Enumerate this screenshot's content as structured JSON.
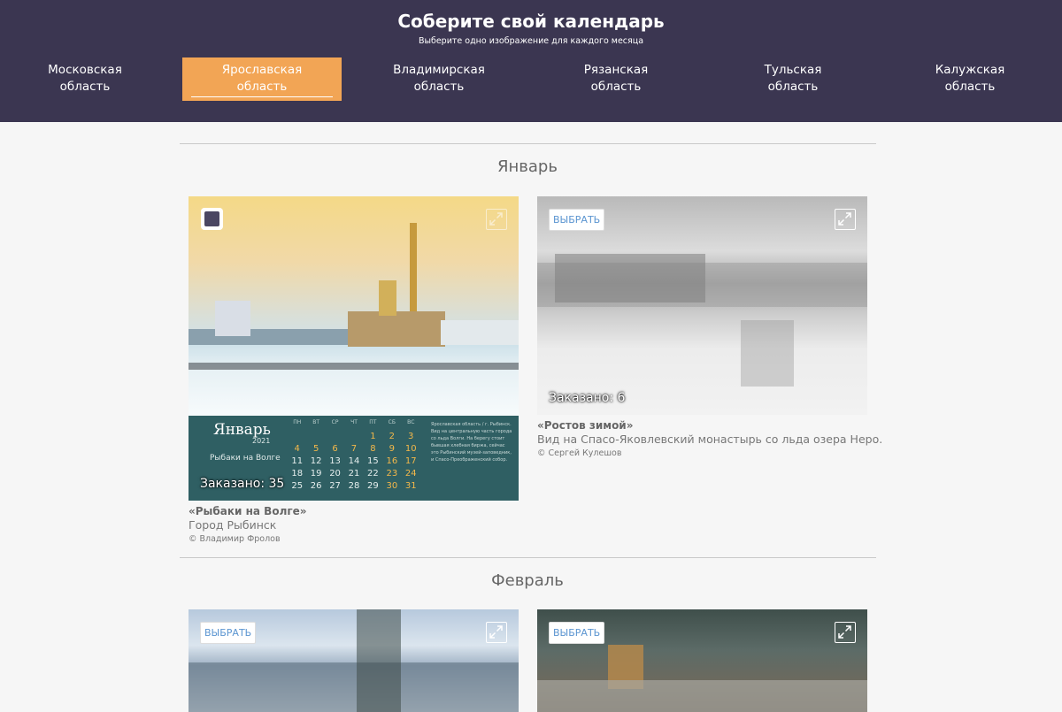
{
  "header": {
    "title": "Соберите свой календарь",
    "subtitle": "Выберите одно изображение для каждого месяца"
  },
  "tabs": [
    {
      "line1": "Московская",
      "line2": "область",
      "active": false
    },
    {
      "line1": "Ярославская",
      "line2": "область",
      "active": true
    },
    {
      "line1": "Владимирская",
      "line2": "область",
      "active": false
    },
    {
      "line1": "Рязанская",
      "line2": "область",
      "active": false
    },
    {
      "line1": "Тульская",
      "line2": "область",
      "active": false
    },
    {
      "line1": "Калужская",
      "line2": "область",
      "active": false
    }
  ],
  "months": [
    {
      "name": "Январь",
      "cards": [
        {
          "title": "«Рыбаки на Волге»",
          "description": "Город Рыбинск",
          "credit": "© Владимир Фролов",
          "ordered": "Заказано: 35",
          "selected": true,
          "calendar": {
            "month": "Январь",
            "year": "2021",
            "caption": "Рыбаки на Волге",
            "weekdays": [
              "ПН",
              "ВТ",
              "СР",
              "ЧТ",
              "ПТ",
              "СБ",
              "ВС"
            ],
            "weeks": [
              [
                "",
                "",
                "",
                "",
                "1",
                "2",
                "3"
              ],
              [
                "4",
                "5",
                "6",
                "7",
                "8",
                "9",
                "10"
              ],
              [
                "11",
                "12",
                "13",
                "14",
                "15",
                "16",
                "17"
              ],
              [
                "18",
                "19",
                "20",
                "21",
                "22",
                "23",
                "24"
              ],
              [
                "25",
                "26",
                "27",
                "28",
                "29",
                "30",
                "31"
              ]
            ],
            "note": "Ярославская область / г. Рыбинск. Вид на центральную часть города со льда Волги. На берегу стоит бывшая хлебная биржа, сейчас это Рыбинский музей-заповедник, и Спасо-Преображенский собор."
          }
        },
        {
          "title": "«Ростов зимой»",
          "description": "Вид на Спасо-Яковлевский монастырь со льда озера Неро.",
          "credit": "© Сергей Кулешов",
          "ordered": "Заказано: 6",
          "pick_label": "ВЫБРАТЬ"
        }
      ]
    },
    {
      "name": "Февраль",
      "cards": [
        {
          "pick_label": "ВЫБРАТЬ"
        },
        {
          "pick_label": "ВЫБРАТЬ"
        }
      ]
    }
  ]
}
